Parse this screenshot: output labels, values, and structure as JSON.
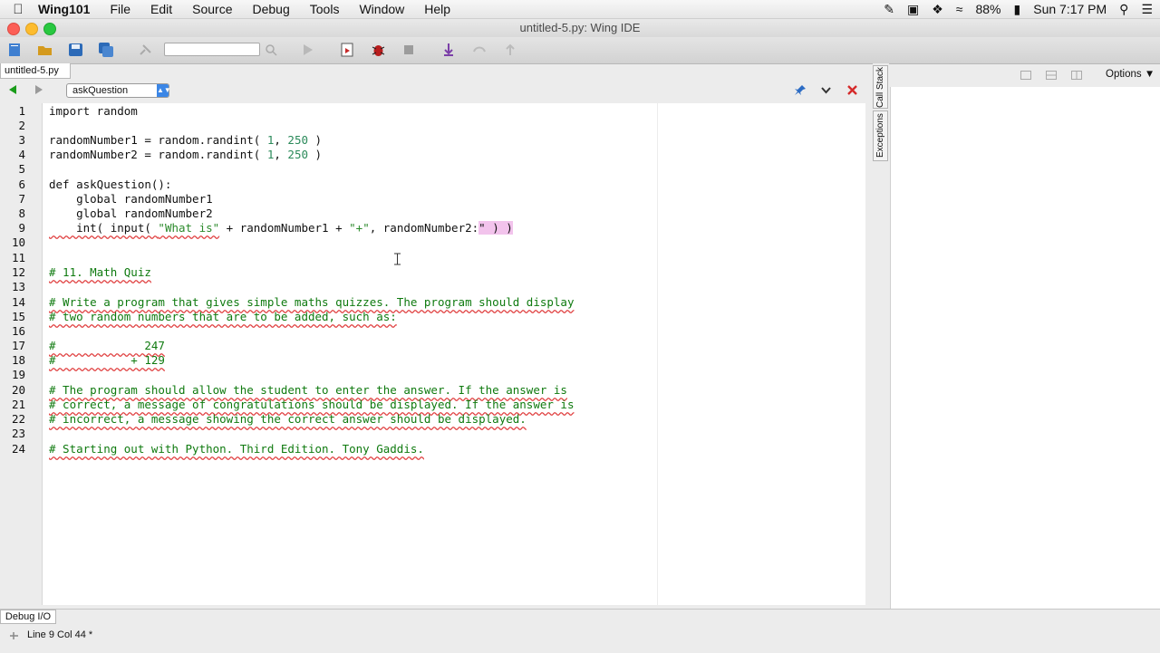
{
  "menubar": {
    "app": "Wing101",
    "items": [
      "File",
      "Edit",
      "Source",
      "Debug",
      "Tools",
      "Window",
      "Help"
    ],
    "battery": "88%",
    "clock": "Sun 7:17 PM"
  },
  "window": {
    "title": "untitled-5.py: Wing IDE"
  },
  "toolbar": {
    "search_value": ""
  },
  "editor": {
    "tab": "untitled-5.py",
    "scope": "askQuestion",
    "lines": [
      {
        "n": "1"
      },
      {
        "n": "2"
      },
      {
        "n": "3"
      },
      {
        "n": "4"
      },
      {
        "n": "5"
      },
      {
        "n": "6"
      },
      {
        "n": "7"
      },
      {
        "n": "8"
      },
      {
        "n": "9"
      },
      {
        "n": "10"
      },
      {
        "n": "11"
      },
      {
        "n": "12"
      },
      {
        "n": "13"
      },
      {
        "n": "14"
      },
      {
        "n": "15"
      },
      {
        "n": "16"
      },
      {
        "n": "17"
      },
      {
        "n": "18"
      },
      {
        "n": "19"
      },
      {
        "n": "20"
      },
      {
        "n": "21"
      },
      {
        "n": "22"
      },
      {
        "n": "23"
      },
      {
        "n": "24"
      }
    ],
    "code": {
      "l1": "import random",
      "l3a": "randomNumber1 = random.randint( ",
      "l3b": "1",
      "l3c": ", ",
      "l3d": "250",
      "l3e": " )",
      "l4a": "randomNumber2 = random.randint( ",
      "l4b": "1",
      "l4c": ", ",
      "l4d": "250",
      "l4e": " )",
      "l6": "def askQuestion():",
      "l7": "    global randomNumber1",
      "l8": "    global randomNumber2",
      "l9a": "    int( input( ",
      "l9b": "\"What is\"",
      "l9c": " + randomNumber1 + ",
      "l9d": "\"+\"",
      "l9e": ", randomNumber2:",
      "l9f": "\" ) )",
      "l12": "# 11. Math Quiz",
      "l14": "# Write a program that gives simple maths quizzes. The program should display",
      "l15": "# two random numbers that are to be added, such as:",
      "l17": "#             247",
      "l18": "#           + 129",
      "l20": "# The program should allow the student to enter the answer. If the answer is",
      "l21": "# correct, a message of congratulations should be displayed. If the answer is",
      "l22": "# incorrect, a message showing the correct answer should be displayed.",
      "l24": "# Starting out with Python. Third Edition. Tony Gaddis."
    }
  },
  "tools": {
    "call_stack_tab": "Call Stack",
    "exceptions_tab": "Exceptions",
    "options_label": "Options"
  },
  "bottom": {
    "debug_tab": "Debug I/O",
    "status": "Line 9 Col 44 *"
  },
  "colors": {
    "accent": "#3b86e6",
    "selection": "#f2c3ec",
    "comment": "#0f7a0f",
    "close": "#d52a2a"
  }
}
